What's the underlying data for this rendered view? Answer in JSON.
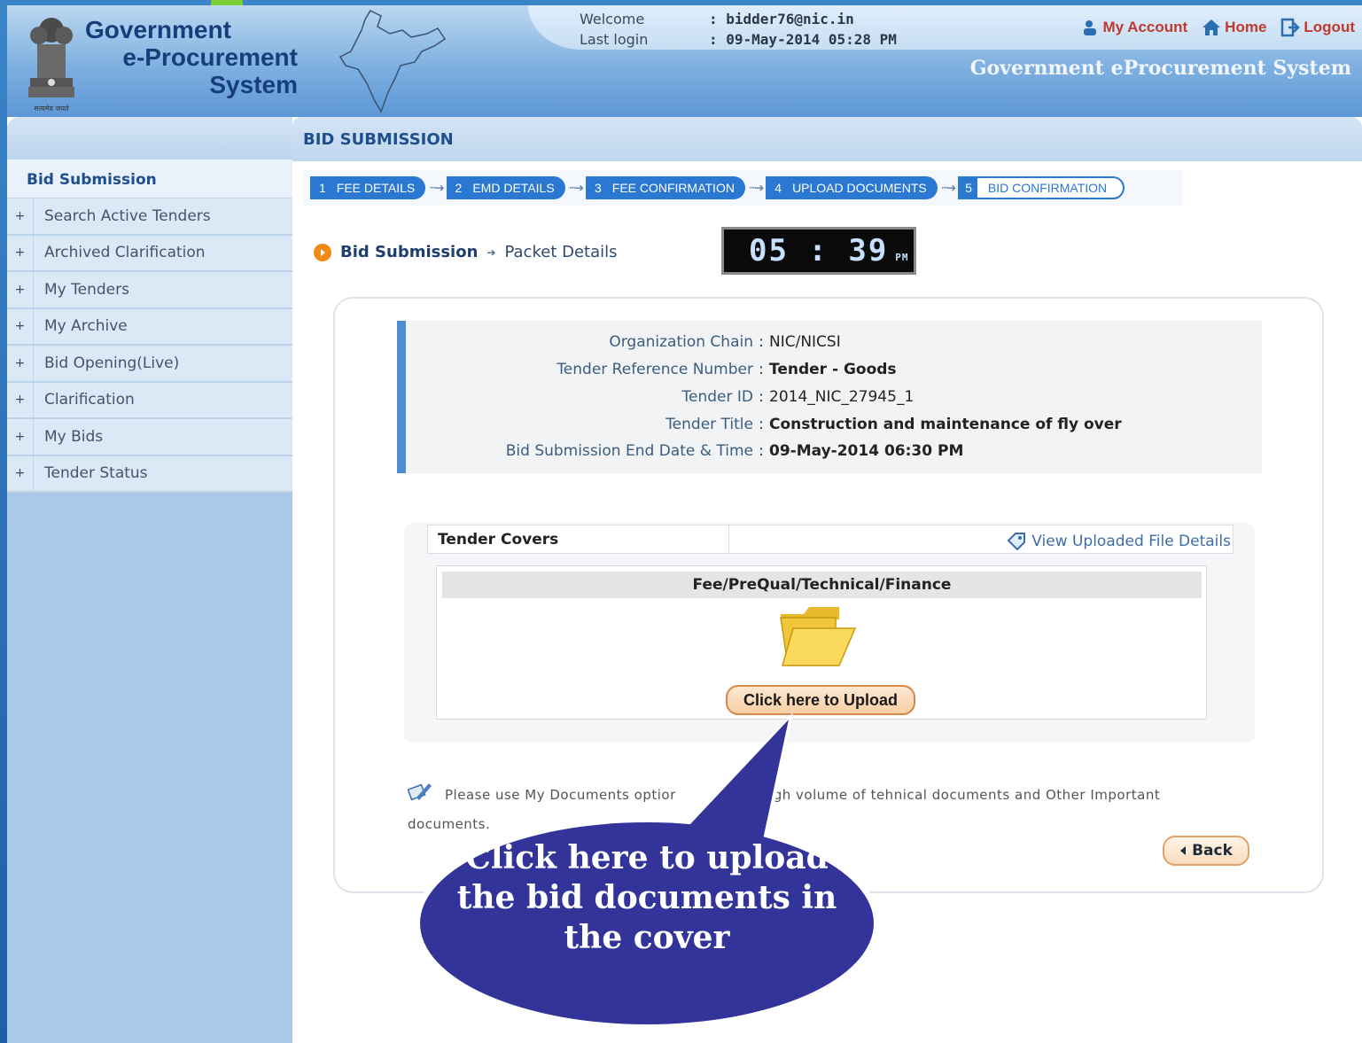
{
  "header": {
    "logo_line1": "Government",
    "logo_line2": "e-Procurement",
    "logo_line3": "System",
    "emblem_motto": "सत्यमेव जयते",
    "welcome_label": "Welcome",
    "welcome_value": ": bidder76@nic.in",
    "last_login_label": "Last login",
    "last_login_value": ": 09-May-2014 05:28 PM",
    "links": {
      "my_account": "My Account",
      "home": "Home",
      "logout": "Logout"
    },
    "system_title": "Government eProcurement System"
  },
  "sidebar": {
    "heading": "Bid Submission",
    "items": [
      {
        "label": "Search Active Tenders"
      },
      {
        "label": "Archived Clarification"
      },
      {
        "label": "My Tenders"
      },
      {
        "label": "My Archive"
      },
      {
        "label": "Bid Opening(Live)"
      },
      {
        "label": "Clarification"
      },
      {
        "label": "My Bids"
      },
      {
        "label": "Tender Status"
      }
    ]
  },
  "main": {
    "section_title": "BID SUBMISSION",
    "steps": [
      {
        "num": "1",
        "label": "FEE DETAILS"
      },
      {
        "num": "2",
        "label": "EMD DETAILS"
      },
      {
        "num": "3",
        "label": "FEE CONFIRMATION"
      },
      {
        "num": "4",
        "label": "UPLOAD DOCUMENTS"
      },
      {
        "num": "5",
        "label": "BID CONFIRMATION"
      }
    ],
    "breadcrumb": {
      "parent": "Bid Submission",
      "current": "Packet Details"
    },
    "clock": {
      "time": "05 : 39",
      "ampm": "PM"
    },
    "tender_info": {
      "org_chain_label": "Organization Chain",
      "org_chain_value": "NIC/NICSI",
      "ref_label": "Tender Reference Number",
      "ref_value": "Tender - Goods",
      "id_label": "Tender ID",
      "id_value": "2014_NIC_27945_1",
      "title_label": "Tender Title",
      "title_value": "Construction and maintenance of fly over",
      "end_label": "Bid Submission End Date & Time",
      "end_value": "09-May-2014 06:30 PM"
    },
    "covers": {
      "heading": "Tender Covers",
      "view_uploaded": "View Uploaded File Details",
      "cover_title": "Fee/PreQual/Technical/Finance",
      "upload_button": "Click here to Upload"
    },
    "note_part1": "Please use My Documents optior",
    "note_part2": "d high volume of tehnical documents and Other Important documents.",
    "back_button": "Back",
    "callout": "Click here to upload the bid documents in the cover"
  },
  "colors": {
    "header_blue": "#5d97d6",
    "step_blue": "#2a78d2",
    "callout_fill": "#33349a",
    "accent_orange": "#f08a14",
    "link_red": "#c0392b"
  }
}
